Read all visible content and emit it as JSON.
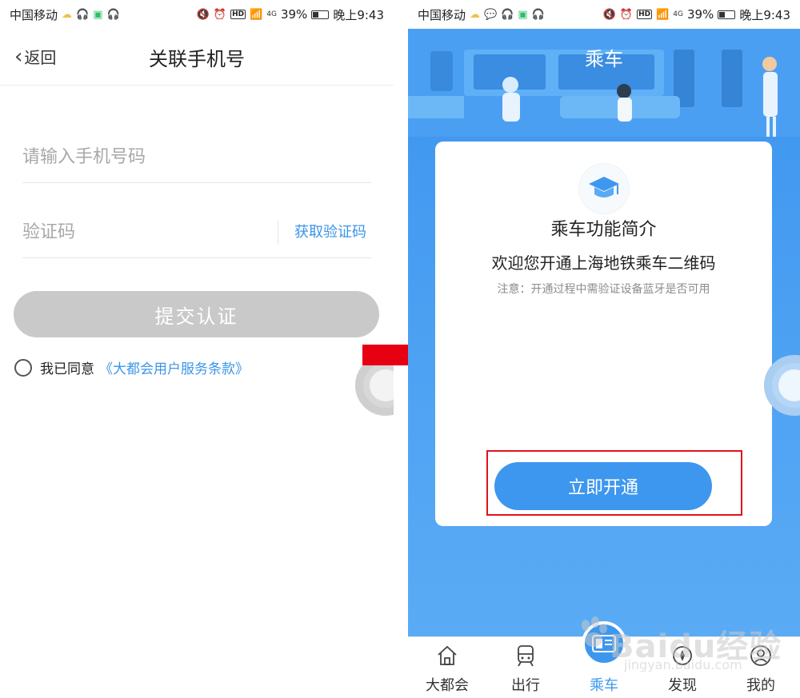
{
  "status_bar": {
    "carrier": "中国移动",
    "battery": "39%",
    "time": "晚上9:43",
    "network": "4G",
    "hd": "HD"
  },
  "left_screen": {
    "back_label": "返回",
    "title": "关联手机号",
    "phone_placeholder": "请输入手机号码",
    "code_placeholder": "验证码",
    "get_code_label": "获取验证码",
    "submit_label": "提交认证",
    "agree_text": "我已同意",
    "terms_link": "《大都会用户服务条款》"
  },
  "right_screen": {
    "title": "乘车",
    "card": {
      "title": "乘车功能简介",
      "subtitle": "欢迎您开通上海地铁乘车二维码",
      "note": "注意：开通过程中需验证设备蓝牙是否可用",
      "button": "立即开通"
    },
    "tabs": [
      {
        "label": "大都会",
        "active": false
      },
      {
        "label": "出行",
        "active": false
      },
      {
        "label": "乘车",
        "active": true
      },
      {
        "label": "发现",
        "active": false
      },
      {
        "label": "我的",
        "active": false
      }
    ]
  },
  "watermark": {
    "brand": "Baidu经验",
    "url": "jingyan.baidu.com"
  },
  "colors": {
    "accent_blue": "#3e97ee",
    "disabled_gray": "#c9c9c9",
    "highlight_red": "#e0121b",
    "arrow_red": "#e60012"
  }
}
